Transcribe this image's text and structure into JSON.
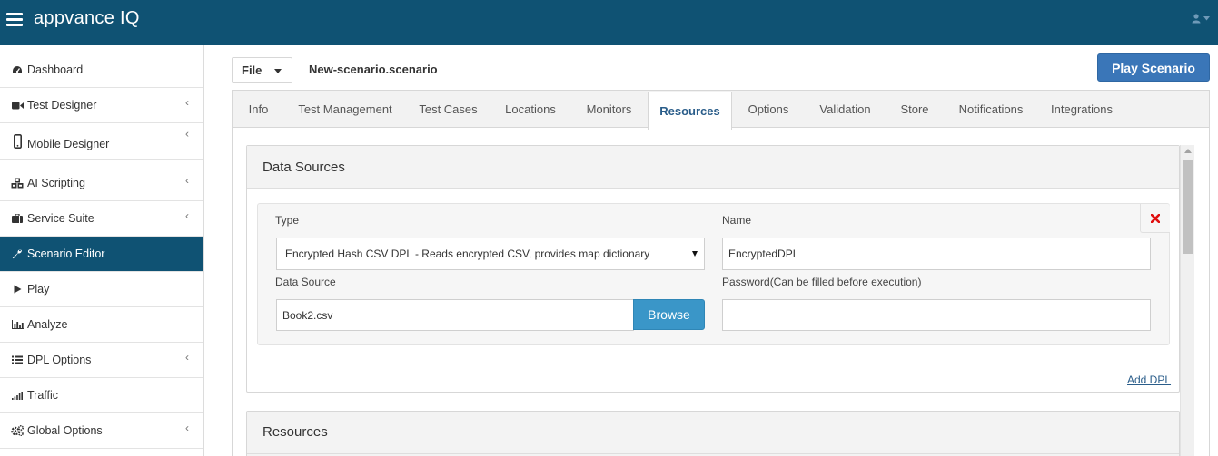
{
  "app": {
    "logo": "appvance IQ"
  },
  "sidebar": {
    "items": [
      {
        "label": "Dashboard",
        "icon": "dashboard-icon",
        "has_chevron": false
      },
      {
        "label": "Test Designer",
        "icon": "video-camera-icon",
        "has_chevron": true
      },
      {
        "label": "Mobile Designer",
        "icon": "mobile-phone-icon",
        "has_chevron": true
      },
      {
        "label": "AI Scripting",
        "icon": "cubes-icon",
        "has_chevron": true
      },
      {
        "label": "Service Suite",
        "icon": "briefcase-icon",
        "has_chevron": true
      },
      {
        "label": "Scenario Editor",
        "icon": "wrench-icon",
        "has_chevron": false,
        "active": true
      },
      {
        "label": "Play",
        "icon": "play-icon",
        "has_chevron": false
      },
      {
        "label": "Analyze",
        "icon": "bar-chart-icon",
        "has_chevron": false
      },
      {
        "label": "DPL Options",
        "icon": "list-icon",
        "has_chevron": true
      },
      {
        "label": "Traffic",
        "icon": "signal-icon",
        "has_chevron": false
      },
      {
        "label": "Global Options",
        "icon": "cogs-icon",
        "has_chevron": true
      }
    ],
    "chevron": "‹"
  },
  "toolbar": {
    "file_label": "File",
    "scenario_name": "New-scenario.scenario",
    "play_label": "Play Scenario"
  },
  "tabs": [
    {
      "label": "Info"
    },
    {
      "label": "Test Management"
    },
    {
      "label": "Test Cases"
    },
    {
      "label": "Locations"
    },
    {
      "label": "Monitors"
    },
    {
      "label": "Resources",
      "active": true
    },
    {
      "label": "Options"
    },
    {
      "label": "Validation"
    },
    {
      "label": "Store"
    },
    {
      "label": "Notifications"
    },
    {
      "label": "Integrations"
    }
  ],
  "data_sources": {
    "title": "Data Sources",
    "type_label": "Type",
    "type_value": "Encrypted Hash CSV DPL - Reads encrypted CSV, provides map dictionary",
    "name_label": "Name",
    "name_value": "EncryptedDPL",
    "data_source_label": "Data Source",
    "data_source_value": "Book2.csv",
    "browse_label": "Browse",
    "password_label": "Password(Can be filled before execution)",
    "password_value": "",
    "add_dpl_label": "Add DPL"
  },
  "resources": {
    "title": "Resources"
  },
  "colors": {
    "topbar": "#0f5273",
    "active_nav": "#0f5273",
    "play_button": "#3a76b8",
    "browse_button": "#3a96c8",
    "remove_icon": "#e01010"
  }
}
